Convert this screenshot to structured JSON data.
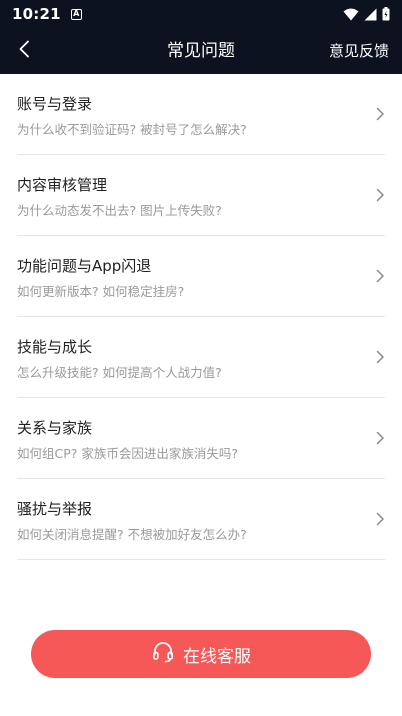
{
  "status_bar": {
    "time": "10:21",
    "notification_icon": "A",
    "icons": [
      "wifi-icon",
      "signal-icon",
      "battery-icon"
    ]
  },
  "nav": {
    "back_icon": "chevron-left-icon",
    "title": "常见问题",
    "feedback_label": "意见反馈"
  },
  "faq_items": [
    {
      "title": "账号与登录",
      "subtitle": "为什么收不到验证码? 被封号了怎么解决?"
    },
    {
      "title": "内容审核管理",
      "subtitle": "为什么动态发不出去? 图片上传失败?"
    },
    {
      "title": "功能问题与App闪退",
      "subtitle": "如何更新版本? 如何稳定挂房?"
    },
    {
      "title": "技能与成长",
      "subtitle": "怎么升级技能? 如何提高个人战力值?"
    },
    {
      "title": "关系与家族",
      "subtitle": "如何组CP? 家族币会因进出家族消失吗?"
    },
    {
      "title": "骚扰与举报",
      "subtitle": "如何关闭消息提醒? 不想被加好友怎么办?"
    }
  ],
  "service_button": {
    "label": "在线客服",
    "icon": "headset-icon"
  },
  "colors": {
    "header_bg": "#0d1220",
    "accent": "#f65757",
    "title_text": "#222222",
    "subtitle_text": "#9a9a9a",
    "divider": "#e6e6e6"
  }
}
